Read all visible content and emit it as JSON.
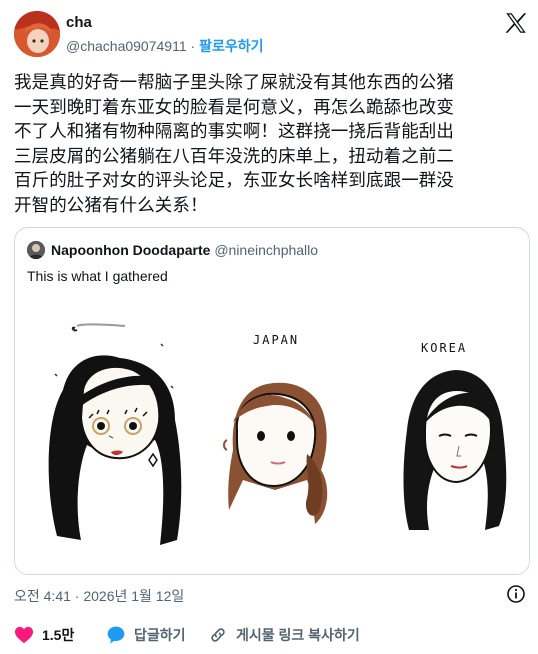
{
  "author": {
    "name": "cha",
    "handle": "@chacha09074911",
    "separator": "·",
    "follow_label": "팔로우하기"
  },
  "tweet": {
    "text": "我是真的好奇一帮脑子里头除了屎就没有其他东西的公猪\n一天到晚盯着东亚女的脸看是何意义，再怎么跪舔也改变\n不了人和猪有物种隔离的事实啊！这群挠一挠后背能刮出\n三层皮屑的公猪躺在八百年没洗的床单上，扭动着之前二\n百斤的肚子对女的评头论足，东亚女长啥样到底跟一群没\n开智的公猪有什么关系！"
  },
  "quote": {
    "name": "Napoonhon Doodaparte",
    "handle": "@nineinchphallo",
    "text": "This is what I gathered",
    "image_labels": {
      "japan": "JAPAN",
      "korea": "KOREA"
    }
  },
  "meta": {
    "timestamp": "오전 4:41 · 2026년 1월 12일"
  },
  "actions": {
    "likes": "1.5만",
    "reply_label": "답글하기",
    "copy_label": "게시물 링크 복사하기"
  },
  "colors": {
    "like": "#f91880",
    "reply": "#1d9bf0",
    "follow": "#1d9bf0"
  },
  "icons": [
    "x-logo-icon",
    "info-icon",
    "heart-icon",
    "reply-bubble-icon",
    "link-icon"
  ]
}
